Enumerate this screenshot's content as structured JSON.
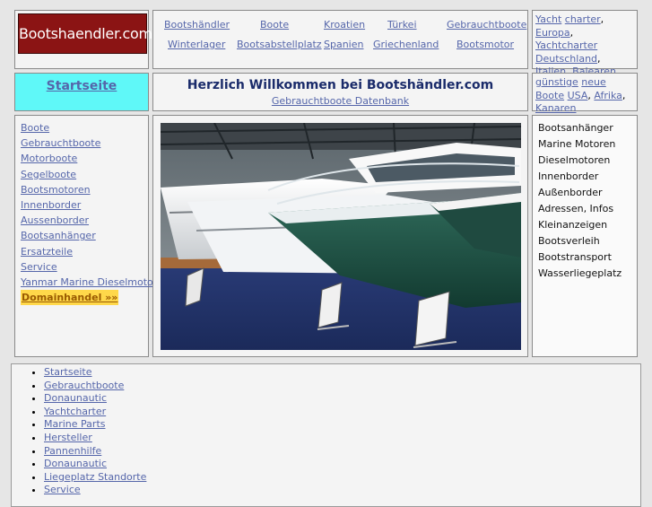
{
  "logo": {
    "text": "Bootshaendler.com"
  },
  "top_nav": [
    "Bootshändler",
    "Boote",
    "Kroatien",
    "Türkei",
    "Gebrauchtboote",
    "Winterlager",
    "Bootsabstellplatz",
    "Spanien",
    "Griechenland",
    "Bootsmotor"
  ],
  "top_right_links": [
    "Yacht",
    "charter",
    "Europa",
    "Yachtcharter",
    "Deutschland",
    "Italien",
    "Balearen"
  ],
  "start": {
    "label": "Startseite"
  },
  "welcome": {
    "title": "Herzlich Willkommen bei Bootshändler.com",
    "sub_link": "Gebrauchtboote Datenbank"
  },
  "info_right": {
    "text1": "günstige",
    "link1": "neue",
    "link2": "Boote",
    "link3": "USA",
    "link4": "Afrika",
    "link5": "Kanaren"
  },
  "left_nav": [
    "Boote",
    "Gebrauchtboote",
    "Motorboote",
    "Segelboote",
    "Bootsmotoren",
    "Innenborder",
    "Aussenborder",
    "Bootsanhänger",
    "Ersatzteile",
    "Service",
    "Yanmar Marine Dieselmotor",
    "Domainhandel »»"
  ],
  "right_list": [
    "Bootsanhänger",
    "Marine Motoren",
    "Dieselmotoren",
    "Innenborder",
    "Außenborder",
    "Adressen, Infos",
    "Kleinanzeigen",
    "Bootsverleih",
    "Bootstransport",
    "Wasserliegeplatz"
  ],
  "bottom_list": [
    "Startseite",
    "Gebrauchtboote",
    "Donaunautic",
    "Yachtcharter",
    "Marine Parts",
    "Hersteller",
    "Pannenhilfe",
    "Donaunautic",
    "Liegeplatz Standorte",
    "Service"
  ],
  "colors": {
    "logo_bg": "#8b1414",
    "start_bg": "#5ff8f8",
    "link": "#5566aa",
    "highlight": "#ffd84a"
  }
}
